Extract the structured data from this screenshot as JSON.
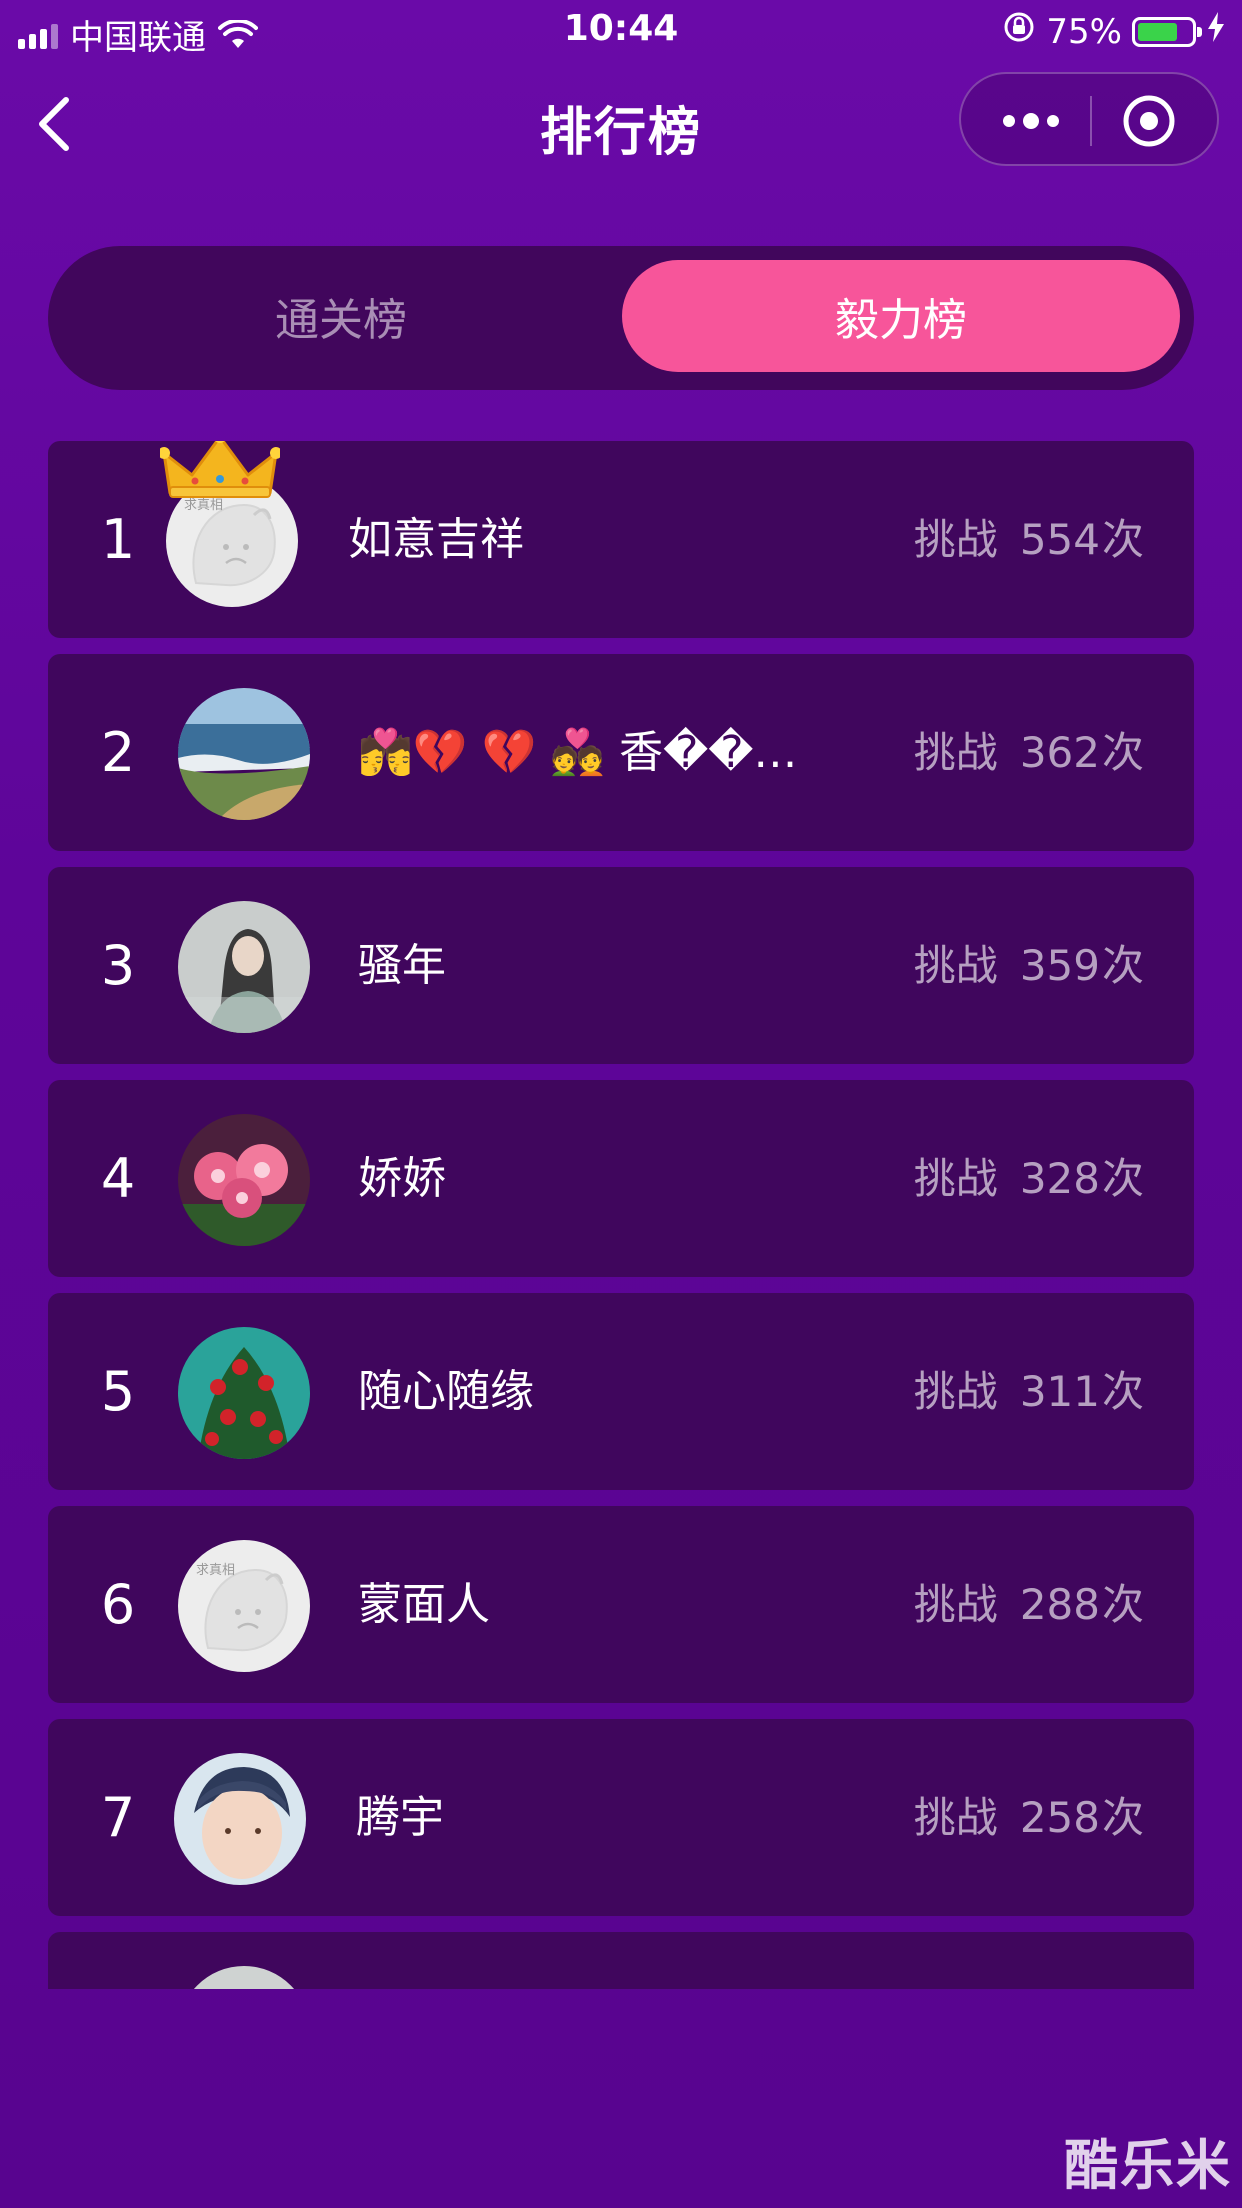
{
  "status_bar": {
    "carrier": "中国联通",
    "time": "10:44",
    "battery_percent": "75%",
    "battery_level": 0.75
  },
  "nav": {
    "title": "排行榜",
    "back_icon": "chevron-left-icon",
    "more_icon": "more-dots-icon",
    "close_icon": "target-close-icon"
  },
  "tabs": [
    {
      "label": "通关榜",
      "active": false
    },
    {
      "label": "毅力榜",
      "active": true
    }
  ],
  "score_prefix": "挑战",
  "score_suffix": "次",
  "leaderboard": [
    {
      "rank": "1",
      "name": "如意吉祥",
      "count": "554",
      "avatar": "default-avatar",
      "crown": true
    },
    {
      "rank": "2",
      "name": "💏💔 💔 💑 香���…",
      "count": "362",
      "avatar": "seascape-avatar"
    },
    {
      "rank": "3",
      "name": "骚年",
      "count": "359",
      "avatar": "girl-photo-avatar"
    },
    {
      "rank": "4",
      "name": "娇娇",
      "count": "328",
      "avatar": "pink-flowers-avatar"
    },
    {
      "rank": "5",
      "name": "随心随缘",
      "count": "311",
      "avatar": "roses-avatar"
    },
    {
      "rank": "6",
      "name": "蒙面人",
      "count": "288",
      "avatar": "default-avatar"
    },
    {
      "rank": "7",
      "name": "腾宇",
      "count": "258",
      "avatar": "boy-photo-avatar"
    }
  ],
  "default_avatar_tag": "求真相",
  "watermark": "酷乐米",
  "colors": {
    "background": "#6a0aa8",
    "card": "#40065d",
    "active_tab": "#f7559a",
    "battery": "#3ad34a"
  }
}
